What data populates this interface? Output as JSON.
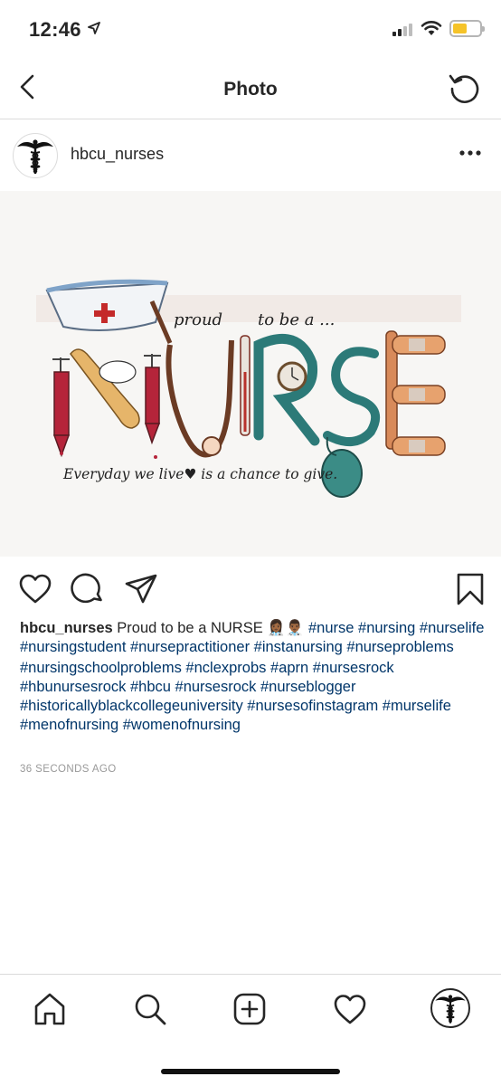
{
  "status_bar": {
    "time": "12:46",
    "battery_color": "#f5c329"
  },
  "nav": {
    "title": "Photo",
    "back_icon": "chevron-left-icon",
    "refresh_icon": "refresh-icon"
  },
  "post": {
    "username": "hbcu_nurses",
    "more_icon": "more-horizontal-icon",
    "image": {
      "text_proud": "proud",
      "text_to_be": "to be a ...",
      "word": "NURSE",
      "tagline": "Everyday we live♥ is a chance to give."
    },
    "caption": {
      "username": "hbcu_nurses",
      "text": "Proud to be a NURSE 👩🏾‍⚕️👨🏾‍⚕️",
      "hashtags_line1": "#nurse #nursing #nurselife #nursingstudent #nursepractitioner #instanursing #nurseproblems",
      "hashtags_line2": "#nursingschoolproblems #nclexprobs #aprn #nursesrock #hbunursesrock #hbcu #nursesrock #nurseblogger #historicallyblackcollegeuniversity #nursesofinstagram #murselife #menofnursing #womenofnursing"
    },
    "timestamp": "36 SECONDS AGO",
    "hashtag_color": "#003569"
  },
  "tabbar": {
    "items": [
      "home-icon",
      "search-icon",
      "add-post-icon",
      "heart-icon",
      "profile-avatar"
    ]
  }
}
